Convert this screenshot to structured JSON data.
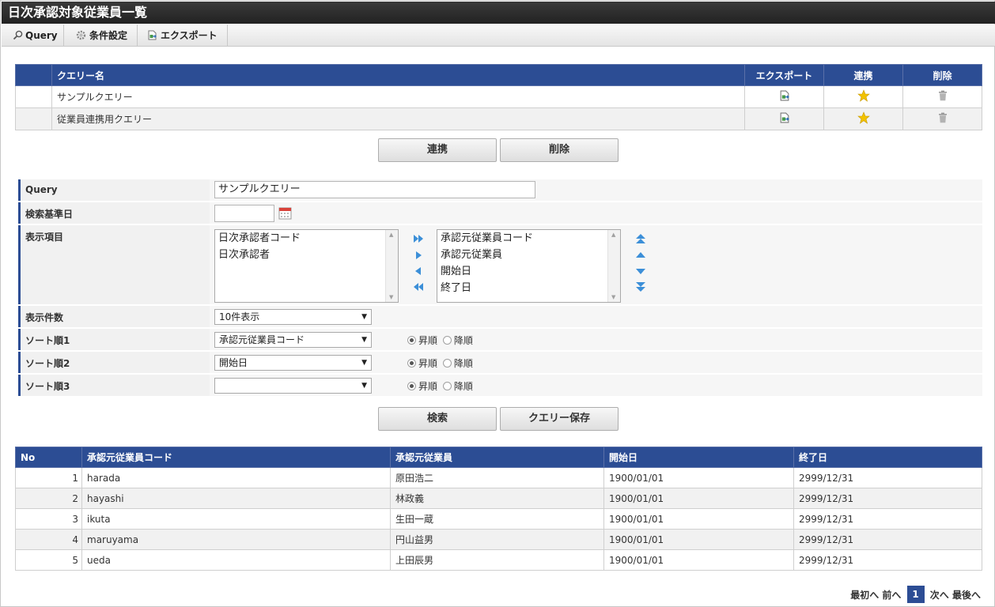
{
  "title": "日次承認対象従業員一覧",
  "toolbar": {
    "query": "Query",
    "settings": "条件設定",
    "export": "エクスポート"
  },
  "query_table": {
    "headers": [
      "",
      "クエリー名",
      "エクスポート",
      "連携",
      "削除"
    ],
    "rows": [
      {
        "name": "サンプルクエリー"
      },
      {
        "name": "従業員連携用クエリー"
      }
    ]
  },
  "actions": {
    "link": "連携",
    "delete": "削除"
  },
  "form": {
    "query_label": "Query",
    "query_value": "サンプルクエリー",
    "base_date_label": "検索基準日",
    "base_date_value": "",
    "items_label": "表示項目",
    "available_items": [
      "日次承認者コード",
      "日次承認者"
    ],
    "selected_items": [
      "承認元従業員コード",
      "承認元従業員",
      "開始日",
      "終了日"
    ],
    "count_label": "表示件数",
    "count_value": "10件表示",
    "sort1_label": "ソート順1",
    "sort1_value": "承認元従業員コード",
    "sort2_label": "ソート順2",
    "sort2_value": "開始日",
    "sort3_label": "ソート順3",
    "sort3_value": "",
    "asc": "昇順",
    "desc": "降順"
  },
  "buttons": {
    "search": "検索",
    "save_query": "クエリー保存"
  },
  "results": {
    "headers": [
      "No",
      "承認元従業員コード",
      "承認元従業員",
      "開始日",
      "終了日"
    ],
    "rows": [
      [
        "1",
        "harada",
        "原田浩二",
        "1900/01/01",
        "2999/12/31"
      ],
      [
        "2",
        "hayashi",
        "林政義",
        "1900/01/01",
        "2999/12/31"
      ],
      [
        "3",
        "ikuta",
        "生田一蔵",
        "1900/01/01",
        "2999/12/31"
      ],
      [
        "4",
        "maruyama",
        "円山益男",
        "1900/01/01",
        "2999/12/31"
      ],
      [
        "5",
        "ueda",
        "上田辰男",
        "1900/01/01",
        "2999/12/31"
      ]
    ]
  },
  "pager": {
    "first": "最初へ",
    "prev": "前へ",
    "current": "1",
    "next": "次へ",
    "last": "最後へ"
  },
  "colors": {
    "header_blue": "#2c4d94",
    "star": "#f2c200"
  }
}
